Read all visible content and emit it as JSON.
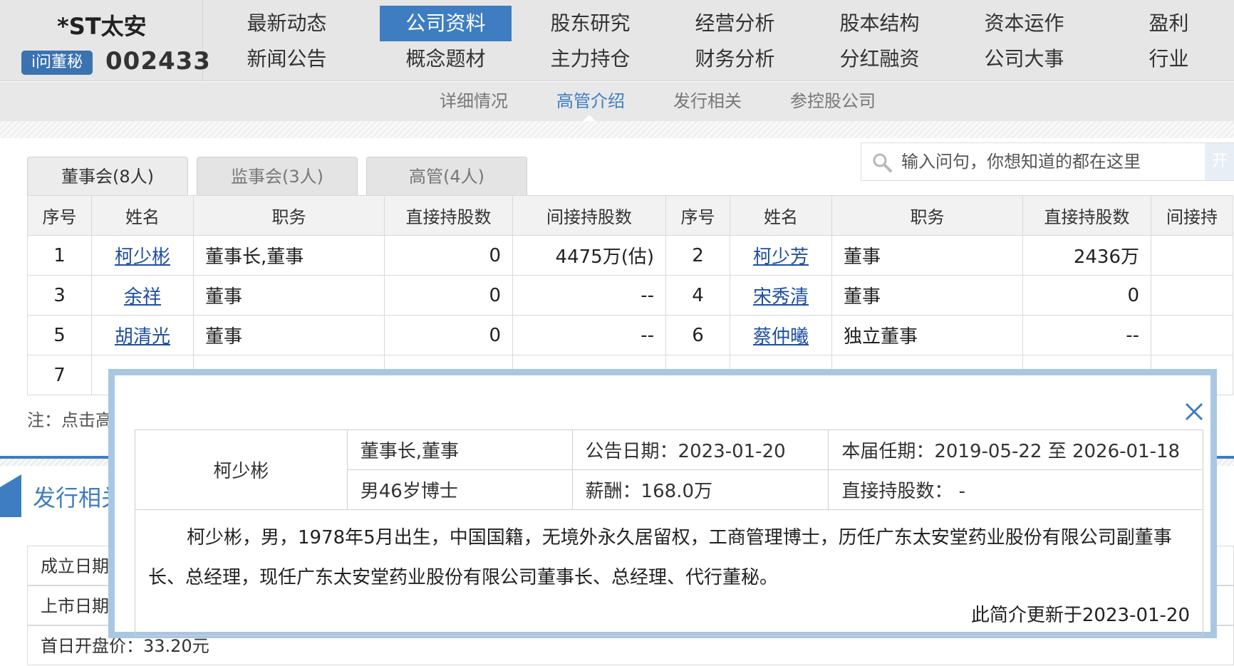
{
  "stock": {
    "name": "*ST太安",
    "ask_label": "i问董秘",
    "code": "002433"
  },
  "nav": {
    "row1": [
      "最新动态",
      "公司资料",
      "股东研究",
      "经营分析",
      "股本结构",
      "资本运作",
      "盈利"
    ],
    "row2": [
      "新闻公告",
      "概念题材",
      "主力持仓",
      "财务分析",
      "分红融资",
      "公司大事",
      "行业"
    ],
    "active": "公司资料"
  },
  "subnav": {
    "items": [
      "详细情况",
      "高管介绍",
      "发行相关",
      "参控股公司"
    ],
    "active": "高管介绍"
  },
  "tabs": [
    "董事会(8人)",
    "监事会(3人)",
    "高管(4人)"
  ],
  "search": {
    "placeholder": "输入问句，你想知道的都在这里",
    "button": "开"
  },
  "table": {
    "headers": [
      "序号",
      "姓名",
      "职务",
      "直接持股数",
      "间接持股数",
      "序号",
      "姓名",
      "职务",
      "直接持股数",
      "间接持"
    ],
    "rows": [
      {
        "no1": "1",
        "name1": "柯少彬",
        "title1": "董事长,董事",
        "direct1": "0",
        "indirect1": "4475万(估)",
        "no2": "2",
        "name2": "柯少芳",
        "title2": "董事",
        "direct2": "2436万",
        "indirect2": ""
      },
      {
        "no1": "3",
        "name1": "余祥",
        "title1": "董事",
        "direct1": "0",
        "indirect1": "--",
        "no2": "4",
        "name2": "宋秀清",
        "title2": "董事",
        "direct2": "0",
        "indirect2": ""
      },
      {
        "no1": "5",
        "name1": "胡清光",
        "title1": "董事",
        "direct1": "0",
        "indirect1": "--",
        "no2": "6",
        "name2": "蔡仲曦",
        "title2": "独立董事",
        "direct2": "--",
        "indirect2": ""
      },
      {
        "no1": "7",
        "name1": "",
        "title1": "",
        "direct1": "",
        "indirect1": "",
        "no2": "",
        "name2": "",
        "title2": "",
        "direct2": "",
        "indirect2": ""
      }
    ]
  },
  "note": "注：点击高",
  "section": {
    "title": "发行相关",
    "rows": [
      "成立日期",
      "上市日期",
      "首日开盘价：33.20元"
    ]
  },
  "popup": {
    "name": "柯少彬",
    "role": "董事长,董事",
    "announce_date": "公告日期：2023-01-20",
    "term": "本届任期：2019-05-22 至 2026-01-18",
    "profile": "男46岁博士",
    "salary": "薪酬：168.0万",
    "direct_shares": "直接持股数：  -",
    "bio": "柯少彬，男，1978年5月出生，中国国籍，无境外永久居留权，工商管理博士，历任广东太安堂药业股份有限公司副董事长、总经理，现任广东太安堂药业股份有限公司董事长、总经理、代行董秘。",
    "updated": "此简介更新于2023-01-20"
  }
}
